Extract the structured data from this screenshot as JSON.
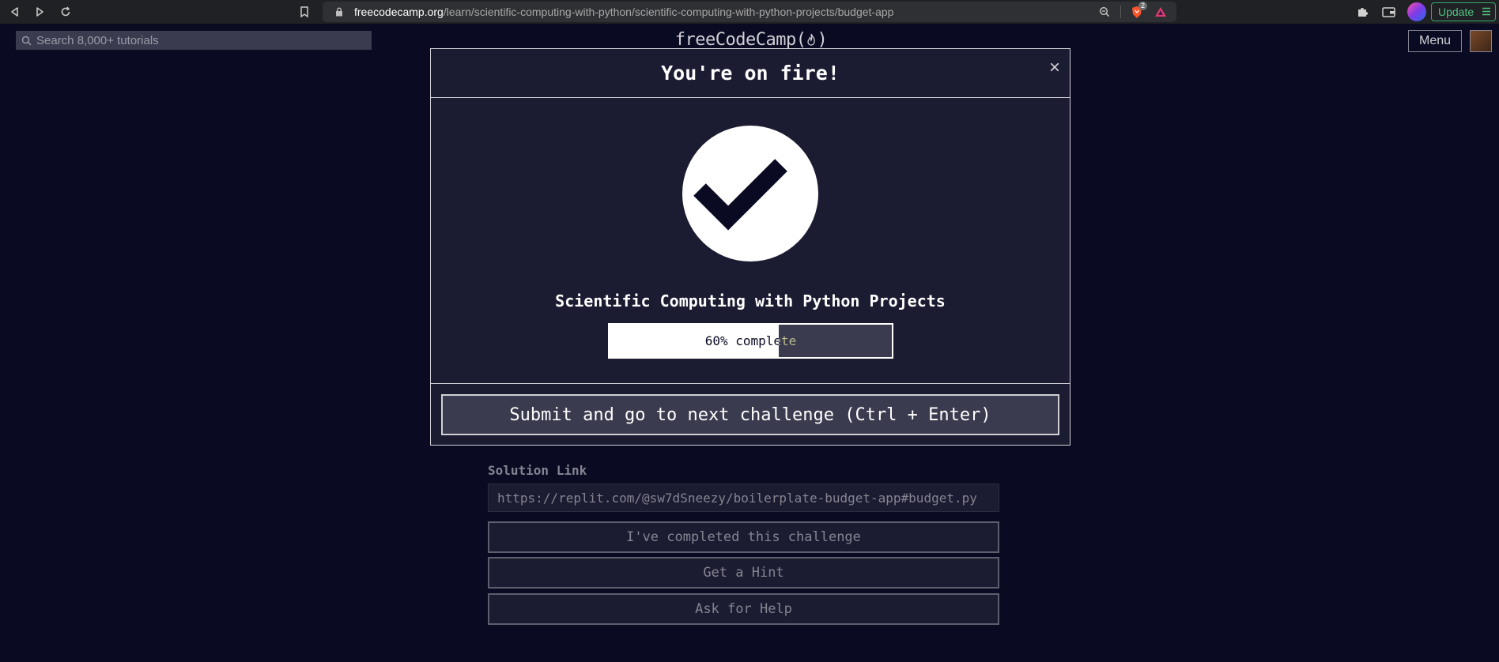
{
  "browser": {
    "url_domain": "freecodecamp.org",
    "url_path": "/learn/scientific-computing-with-python/scientific-computing-with-python-projects/budget-app",
    "update_label": "Update",
    "extension_badge": "2",
    "icons": [
      "back-icon",
      "forward-icon",
      "reload-icon",
      "bookmark-icon",
      "lock-icon",
      "zoom-icon",
      "brave-shield-icon",
      "brave-rewards-icon",
      "puzzle-icon",
      "wallet-icon",
      "profile-icon",
      "menu-icon"
    ]
  },
  "nav": {
    "search_placeholder": "Search 8,000+ tutorials",
    "brand": "freeCodeCamp(🔥)",
    "brand_text": "freeCodeCamp(",
    "brand_close": ")",
    "menu_label": "Menu"
  },
  "modal": {
    "title": "You're on fire!",
    "close_symbol": "×",
    "cert_title": "Scientific Computing with Python Projects",
    "progress_percent": 60,
    "progress_label": "60% complete",
    "submit_label": "Submit and go to next challenge (Ctrl + Enter)"
  },
  "page": {
    "solution_label": "Solution Link",
    "solution_value": "https://replit.com/@sw7dSneezy/boilerplate-budget-app#budget.py",
    "completed_label": "I've completed this challenge",
    "hint_label": "Get a Hint",
    "help_label": "Ask for Help"
  },
  "colors": {
    "background": "#0a0a23",
    "modal_bg": "#1b1b32",
    "button_bg": "#3b3b4f",
    "text": "#ffffff",
    "muted": "#858591"
  }
}
